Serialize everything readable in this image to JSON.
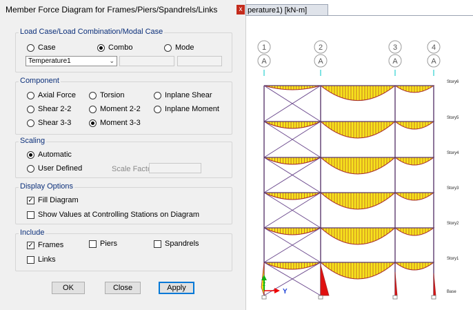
{
  "dialog": {
    "title": "Member Force Diagram for Frames/Piers/Spandrels/Links",
    "close_glyph": "x",
    "load_case": {
      "label": "Load Case/Load Combination/Modal Case",
      "options": [
        "Case",
        "Combo",
        "Mode"
      ],
      "selected": "Combo",
      "selected_value": "Temperature1"
    },
    "component": {
      "label": "Component",
      "options": [
        "Axial Force",
        "Torsion",
        "Inplane Shear",
        "Shear 2-2",
        "Moment 2-2",
        "Inplane Moment",
        "Shear 3-3",
        "Moment 3-3"
      ],
      "selected": "Moment 3-3"
    },
    "scaling": {
      "label": "Scaling",
      "options": [
        "Automatic",
        "User Defined"
      ],
      "selected": "Automatic",
      "scale_factor_label": "Scale Factor"
    },
    "display": {
      "label": "Display Options",
      "fill_diagram": "Fill Diagram",
      "fill_checked": true,
      "show_values": "Show Values at Controlling Stations on Diagram",
      "show_values_checked": false
    },
    "include": {
      "label": "Include",
      "frames": "Frames",
      "frames_checked": true,
      "piers": "Piers",
      "spandrels": "Spandrels",
      "links": "Links"
    },
    "buttons": {
      "ok": "OK",
      "close": "Close",
      "apply": "Apply"
    }
  },
  "model_window": {
    "tab_title": "perature1)  [kN-m]",
    "grid_numbers": [
      "1",
      "2",
      "3",
      "4"
    ],
    "grid_letter": "A",
    "story_labels": [
      "Story6",
      "Story5",
      "Story4",
      "Story3",
      "Story2",
      "Story1",
      "Base"
    ],
    "axis_y": "Y",
    "axis_z": "Z",
    "colors": {
      "fill": "#f7e51c",
      "outline": "#a52a2a",
      "frame": "#5c3a6e",
      "brace": "#6c4a8e",
      "column_moment": "#e01010"
    }
  }
}
